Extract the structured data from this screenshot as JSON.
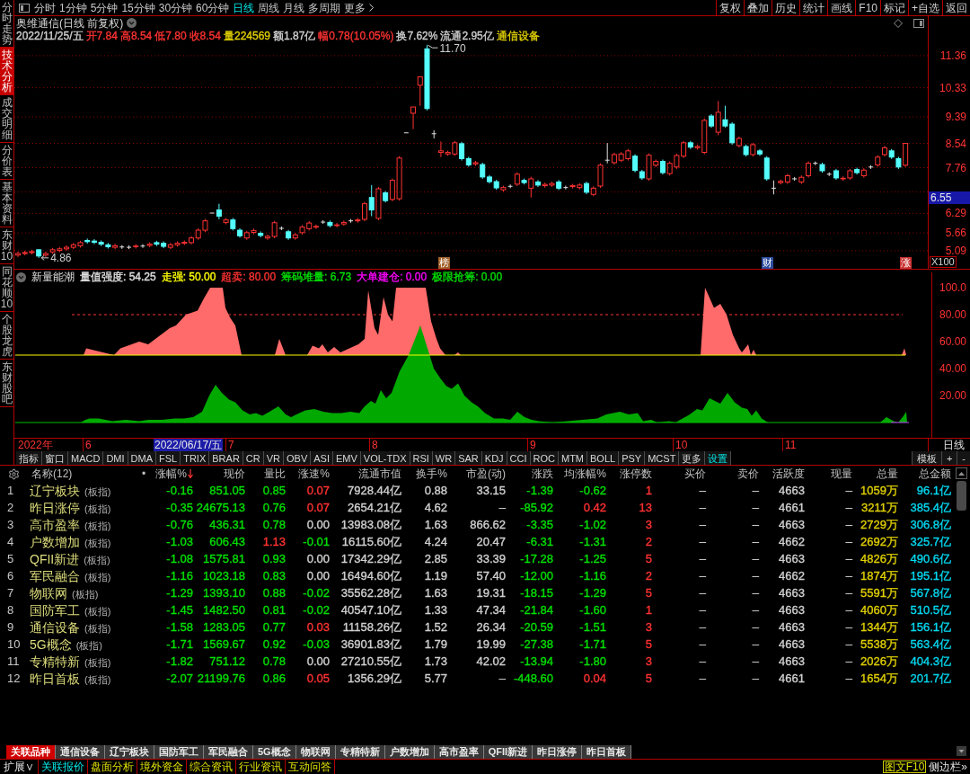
{
  "side_tabs": [
    {
      "label": "分时走势",
      "selected": false
    },
    {
      "label": "技术分析",
      "selected": true
    },
    {
      "label": "成交明细",
      "selected": false
    },
    {
      "label": "分价表",
      "selected": false
    },
    {
      "label": "基本资料",
      "selected": false
    },
    {
      "label": "东财10",
      "selected": false
    },
    {
      "label": "同花顺10",
      "selected": false
    },
    {
      "label": "个股龙虎",
      "selected": false
    },
    {
      "label": "东财股吧",
      "selected": false
    }
  ],
  "toolbar": {
    "period_tabs": [
      {
        "label": "分时",
        "selected": false
      },
      {
        "label": "1分钟",
        "selected": false
      },
      {
        "label": "5分钟",
        "selected": false
      },
      {
        "label": "15分钟",
        "selected": false
      },
      {
        "label": "30分钟",
        "selected": false
      },
      {
        "label": "60分钟",
        "selected": false
      },
      {
        "label": "日线",
        "selected": true
      },
      {
        "label": "周线",
        "selected": false
      },
      {
        "label": "月线",
        "selected": false
      },
      {
        "label": "多周期",
        "selected": false
      },
      {
        "label": "更多",
        "selected": false
      }
    ],
    "buttons": [
      "复权",
      "叠加",
      "历史",
      "统计",
      "画线",
      "F10",
      "标记",
      "+自选",
      "返回"
    ]
  },
  "price_chart": {
    "title": "奥维通信(日线 前复权)",
    "quote": [
      {
        "text": "2022/11/25/五",
        "color": "#d0d0d0"
      },
      {
        "text": "开7.84",
        "color": "#ff3232"
      },
      {
        "text": "高8.54",
        "color": "#ff3232"
      },
      {
        "text": "低7.80",
        "color": "#ff3232"
      },
      {
        "text": "收8.54",
        "color": "#ff3232"
      },
      {
        "text": "量224569",
        "color": "#e0d000"
      },
      {
        "text": "额1.87亿",
        "color": "#d0d0d0"
      },
      {
        "text": "幅0.78(10.05%)",
        "color": "#ff3232"
      },
      {
        "text": "换7.62%",
        "color": "#d0d0d0"
      },
      {
        "text": "流通2.95亿",
        "color": "#d0d0d0"
      },
      {
        "text": "通信设备",
        "color": "#e0d000"
      }
    ],
    "high_label": "11.70",
    "low_label": "4.86",
    "cursor_price": "6.55",
    "scale": "X100",
    "events": [
      {
        "text": "榜",
        "color": "#a0602a"
      },
      {
        "text": "财",
        "color": "#2c4c9c"
      },
      {
        "text": "涨",
        "color": "#c83232"
      }
    ],
    "chart_data": {
      "type": "candlestick",
      "categories": [
        null,
        null,
        null,
        null,
        null,
        null,
        null,
        null,
        null,
        null,
        null,
        null,
        null,
        null,
        null,
        null,
        null,
        null,
        null,
        null,
        null,
        null,
        null,
        null,
        null,
        null,
        null,
        null,
        null,
        null,
        null,
        null,
        null,
        null,
        null,
        null,
        null,
        null,
        null,
        null,
        null,
        null,
        null,
        null,
        null,
        null,
        null,
        null,
        null,
        null,
        null,
        null,
        null,
        null,
        null,
        null,
        null,
        null,
        null,
        null,
        null,
        null,
        null,
        null,
        null,
        null,
        null,
        null,
        null,
        null,
        null,
        null,
        null,
        null,
        null,
        null,
        null,
        null,
        null,
        null,
        null,
        null,
        null,
        null,
        null,
        null,
        null,
        null,
        null,
        null,
        null,
        null,
        null,
        null,
        null,
        null,
        null,
        null,
        null,
        null,
        null,
        null,
        null,
        null,
        null,
        null,
        null,
        null,
        null,
        null,
        null,
        null,
        null,
        null,
        null,
        null,
        null,
        null,
        null,
        null,
        null,
        null,
        null,
        null,
        null,
        null,
        null,
        null,
        null
      ],
      "ohlc": [
        [
          4.95,
          5.06,
          4.89,
          5.0
        ],
        [
          5.0,
          5.09,
          4.94,
          5.03
        ],
        [
          5.03,
          5.12,
          4.97,
          5.06
        ],
        [
          5.12,
          5.14,
          4.86,
          4.92
        ],
        [
          4.95,
          5.06,
          4.89,
          5.0
        ],
        [
          5.05,
          5.18,
          4.99,
          5.12
        ],
        [
          5.1,
          5.21,
          5.04,
          5.15
        ],
        [
          5.15,
          5.26,
          5.09,
          5.2
        ],
        [
          5.2,
          5.34,
          5.14,
          5.28
        ],
        [
          5.25,
          5.41,
          5.19,
          5.35
        ],
        [
          5.42,
          5.48,
          5.32,
          5.38
        ],
        [
          5.4,
          5.46,
          5.3,
          5.36
        ],
        [
          5.36,
          5.42,
          5.24,
          5.3
        ],
        [
          5.28,
          5.34,
          5.16,
          5.22
        ],
        [
          5.2,
          5.31,
          5.14,
          5.25
        ],
        [
          5.21,
          5.27,
          5.15,
          5.21
        ],
        [
          5.2,
          5.26,
          5.14,
          5.2
        ],
        [
          5.22,
          5.3,
          5.16,
          5.24
        ],
        [
          5.24,
          5.3,
          5.18,
          5.24
        ],
        [
          5.26,
          5.36,
          5.2,
          5.3
        ],
        [
          5.35,
          5.41,
          5.24,
          5.3
        ],
        [
          5.33,
          5.39,
          5.17,
          5.23
        ],
        [
          5.2,
          5.34,
          5.14,
          5.28
        ],
        [
          5.28,
          5.39,
          5.22,
          5.33
        ],
        [
          5.33,
          5.42,
          5.27,
          5.36
        ],
        [
          5.35,
          5.56,
          5.29,
          5.5
        ],
        [
          5.5,
          5.81,
          5.44,
          5.75
        ],
        [
          5.75,
          6.11,
          5.69,
          6.05
        ],
        [
          6.3,
          6.3,
          6.3,
          6.3
        ],
        [
          6.4,
          6.6,
          6.1,
          6.2
        ],
        [
          6.0,
          6.14,
          5.94,
          6.08
        ],
        [
          6.08,
          6.14,
          5.74,
          5.8
        ],
        [
          5.75,
          5.81,
          5.51,
          5.57
        ],
        [
          5.5,
          5.73,
          5.44,
          5.67
        ],
        [
          5.68,
          5.8,
          5.62,
          5.74
        ],
        [
          5.65,
          5.71,
          5.52,
          5.58
        ],
        [
          5.5,
          5.61,
          5.44,
          5.55
        ],
        [
          5.55,
          6.05,
          5.49,
          5.99
        ],
        [
          5.81,
          5.87,
          5.75,
          5.81
        ],
        [
          5.7,
          5.76,
          5.44,
          5.5
        ],
        [
          5.5,
          5.66,
          5.44,
          5.6
        ],
        [
          5.67,
          5.91,
          5.61,
          5.85
        ],
        [
          5.8,
          6.04,
          5.74,
          5.98
        ],
        [
          5.85,
          5.93,
          5.79,
          5.87
        ],
        [
          6.01,
          6.07,
          5.95,
          6.01
        ],
        [
          6.0,
          6.06,
          5.84,
          5.9
        ],
        [
          5.9,
          5.98,
          5.84,
          5.92
        ],
        [
          5.95,
          6.06,
          5.89,
          6.0
        ],
        [
          6.05,
          6.11,
          5.99,
          6.05
        ],
        [
          6.05,
          6.14,
          5.99,
          6.08
        ],
        [
          6.1,
          6.66,
          6.04,
          6.6
        ],
        [
          6.8,
          7.2,
          6.2,
          6.4
        ],
        [
          6.13,
          7.14,
          6.07,
          7.08
        ],
        [
          6.95,
          7.01,
          6.64,
          6.7
        ],
        [
          6.74,
          7.41,
          6.68,
          7.35
        ],
        [
          6.76,
          8.13,
          6.7,
          8.07
        ],
        [
          8.88,
          8.88,
          8.88,
          8.88
        ],
        [
          9.51,
          9.71,
          9.0,
          9.71
        ],
        [
          10.41,
          10.68,
          9.75,
          10.68
        ],
        [
          11.58,
          11.7,
          9.6,
          9.66
        ],
        [
          8.85,
          8.96,
          8.7,
          8.85
        ],
        [
          8.25,
          8.6,
          8.1,
          8.3
        ],
        [
          8.2,
          8.31,
          8.14,
          8.25
        ],
        [
          8.2,
          8.62,
          8.14,
          8.56
        ],
        [
          8.53,
          8.59,
          7.99,
          8.05
        ],
        [
          8.05,
          8.11,
          7.79,
          7.85
        ],
        [
          7.88,
          7.98,
          7.82,
          7.92
        ],
        [
          7.86,
          7.92,
          7.4,
          7.46
        ],
        [
          7.46,
          7.52,
          7.25,
          7.31
        ],
        [
          7.31,
          7.37,
          7.05,
          7.11
        ],
        [
          7.05,
          7.18,
          6.99,
          7.12
        ],
        [
          7.16,
          7.22,
          7.1,
          7.16
        ],
        [
          7.23,
          7.61,
          7.17,
          7.55
        ],
        [
          7.35,
          7.41,
          7.22,
          7.28
        ],
        [
          7.1,
          7.47,
          6.8,
          7.4
        ],
        [
          7.3,
          7.36,
          7.14,
          7.2
        ],
        [
          7.18,
          7.28,
          7.12,
          7.22
        ],
        [
          7.2,
          7.31,
          7.14,
          7.25
        ],
        [
          7.3,
          7.36,
          7.04,
          7.1
        ],
        [
          7.12,
          7.18,
          7.06,
          7.12
        ],
        [
          7.15,
          7.24,
          7.09,
          7.18
        ],
        [
          7.12,
          7.26,
          7.06,
          7.2
        ],
        [
          7.25,
          7.31,
          6.91,
          6.97
        ],
        [
          6.9,
          7.16,
          6.84,
          7.1
        ],
        [
          7.17,
          7.9,
          7.11,
          7.84
        ],
        [
          8.0,
          8.55,
          7.9,
          8.0
        ],
        [
          7.92,
          8.24,
          7.86,
          8.18
        ],
        [
          8.0,
          8.26,
          7.94,
          8.2
        ],
        [
          8.05,
          8.36,
          7.99,
          8.3
        ],
        [
          8.13,
          8.19,
          7.61,
          7.67
        ],
        [
          7.63,
          7.69,
          7.37,
          7.43
        ],
        [
          7.4,
          8.22,
          7.34,
          8.16
        ],
        [
          7.84,
          8.02,
          7.78,
          7.96
        ],
        [
          7.96,
          8.02,
          7.54,
          7.6
        ],
        [
          7.57,
          7.96,
          7.51,
          7.9
        ],
        [
          7.78,
          8.21,
          7.72,
          8.15
        ],
        [
          8.13,
          8.62,
          8.07,
          8.56
        ],
        [
          8.56,
          8.62,
          8.36,
          8.42
        ],
        [
          8.4,
          8.5,
          8.34,
          8.44
        ],
        [
          8.25,
          9.34,
          8.19,
          9.28
        ],
        [
          9.42,
          9.48,
          9.04,
          9.1
        ],
        [
          8.9,
          9.9,
          8.8,
          9.54
        ],
        [
          9.3,
          9.75,
          9.05,
          9.1
        ],
        [
          9.16,
          9.22,
          8.5,
          8.56
        ],
        [
          8.47,
          8.76,
          8.41,
          8.7
        ],
        [
          8.44,
          8.5,
          8.12,
          8.18
        ],
        [
          8.18,
          8.56,
          8.12,
          8.5
        ],
        [
          8.3,
          8.36,
          8.14,
          8.2
        ],
        [
          8.07,
          8.13,
          7.34,
          7.4
        ],
        [
          7.1,
          7.35,
          6.9,
          7.1
        ],
        [
          7.28,
          7.38,
          7.22,
          7.32
        ],
        [
          7.3,
          7.56,
          7.24,
          7.5
        ],
        [
          7.4,
          7.46,
          7.34,
          7.4
        ],
        [
          7.3,
          7.51,
          7.24,
          7.45
        ],
        [
          7.5,
          7.96,
          7.44,
          7.9
        ],
        [
          7.9,
          7.96,
          7.84,
          7.9
        ],
        [
          7.86,
          7.92,
          7.6,
          7.66
        ],
        [
          7.55,
          7.61,
          7.49,
          7.55
        ],
        [
          7.66,
          7.72,
          7.37,
          7.43
        ],
        [
          7.4,
          7.48,
          7.34,
          7.42
        ],
        [
          7.43,
          7.72,
          7.37,
          7.66
        ],
        [
          7.7,
          7.76,
          7.54,
          7.6
        ],
        [
          7.5,
          7.74,
          7.44,
          7.68
        ],
        [
          7.78,
          7.84,
          7.72,
          7.78
        ],
        [
          7.85,
          8.16,
          7.79,
          8.1
        ],
        [
          8.18,
          8.46,
          8.12,
          8.4
        ],
        [
          8.3,
          8.36,
          8.04,
          8.1
        ],
        [
          8.05,
          8.11,
          7.72,
          7.78
        ],
        [
          7.84,
          8.54,
          7.78,
          8.54
        ]
      ],
      "ylim": [
        4.48,
        12.63
      ],
      "grid": true,
      "yticks": [
        {
          "value": 11.36,
          "label": "11.36"
        },
        {
          "value": 10.33,
          "label": "10.33"
        },
        {
          "value": 9.39,
          "label": "9.39"
        },
        {
          "value": 8.54,
          "label": "8.54"
        },
        {
          "value": 7.76,
          "label": "7.76"
        },
        {
          "value": 6.29,
          "label": "6.29"
        },
        {
          "value": 5.66,
          "label": "5.66"
        },
        {
          "value": 5.09,
          "label": "5.09"
        }
      ]
    }
  },
  "indicator": {
    "name": "新量能潮",
    "readings": [
      {
        "text": "量值强度: 54.25",
        "color": "#e0e0e0"
      },
      {
        "text": "走强: 50.00",
        "color": "#ffff00"
      },
      {
        "text": "超卖: 80.00",
        "color": "#ff3232"
      },
      {
        "text": "筹码堆量: 6.73",
        "color": "#00e000"
      },
      {
        "text": "大单建仓: 0.00",
        "color": "#ff00ff"
      },
      {
        "text": "极限抢筹: 0.00",
        "color": "#00e000"
      }
    ],
    "y_axis": [
      "100.0",
      "80.00",
      "60.00",
      "40.00",
      "20.00"
    ]
  },
  "date_axis": {
    "year": "2022年",
    "months": [
      "6",
      "7",
      "8",
      "9",
      "10",
      "11"
    ],
    "cursor_date": "2022/06/17/五",
    "period": "日线"
  },
  "indicator_tabs": [
    {
      "label": "指标",
      "selected": false
    },
    {
      "label": "窗口",
      "selected": false
    },
    {
      "label": "MACD",
      "selected": false
    },
    {
      "label": "DMI",
      "selected": false
    },
    {
      "label": "DMA",
      "selected": false
    },
    {
      "label": "FSL",
      "selected": false
    },
    {
      "label": "TRIX",
      "selected": false
    },
    {
      "label": "BRAR",
      "selected": false
    },
    {
      "label": "CR",
      "selected": false
    },
    {
      "label": "VR",
      "selected": false
    },
    {
      "label": "OBV",
      "selected": false
    },
    {
      "label": "ASI",
      "selected": false
    },
    {
      "label": "EMV",
      "selected": false
    },
    {
      "label": "VOL-TDX",
      "selected": false
    },
    {
      "label": "RSI",
      "selected": false
    },
    {
      "label": "WR",
      "selected": false
    },
    {
      "label": "SAR",
      "selected": false
    },
    {
      "label": "KDJ",
      "selected": false
    },
    {
      "label": "CCI",
      "selected": false
    },
    {
      "label": "ROC",
      "selected": false
    },
    {
      "label": "MTM",
      "selected": false
    },
    {
      "label": "BOLL",
      "selected": false
    },
    {
      "label": "PSY",
      "selected": false
    },
    {
      "label": "MCST",
      "selected": false
    },
    {
      "label": "更多",
      "selected": false
    },
    {
      "label": "设置",
      "selected": true
    }
  ],
  "template_buttons": [
    "模板",
    "+",
    "-"
  ],
  "table": {
    "name_header": "名称(12)",
    "dot_header": "•",
    "columns": [
      {
        "label": "涨幅%",
        "kind": "signed",
        "sorted": true
      },
      {
        "label": "现价",
        "kind": "signed",
        "sorted": false
      },
      {
        "label": "量比",
        "kind": "signed",
        "sorted": false
      },
      {
        "label": "涨速%",
        "kind": "signed",
        "sorted": false
      },
      {
        "label": "流通市值",
        "kind": "plain",
        "sorted": false
      },
      {
        "label": "换手%",
        "kind": "plain",
        "sorted": false
      },
      {
        "label": "市盈(动)",
        "kind": "plain",
        "sorted": false
      },
      {
        "label": "涨跌",
        "kind": "signed",
        "sorted": false
      },
      {
        "label": "均涨幅%",
        "kind": "signed",
        "sorted": false
      },
      {
        "label": "涨停数",
        "kind": "count",
        "sorted": false
      },
      {
        "label": "买价",
        "kind": "plain",
        "sorted": false
      },
      {
        "label": "卖价",
        "kind": "plain",
        "sorted": false
      },
      {
        "label": "活跃度",
        "kind": "plain",
        "sorted": false
      },
      {
        "label": "现量",
        "kind": "plain",
        "sorted": false
      },
      {
        "label": "总量",
        "kind": "volume",
        "sorted": false
      },
      {
        "label": "总金额",
        "kind": "amount",
        "sorted": false
      }
    ],
    "rows": [
      {
        "index": "1",
        "name": "辽宁板块",
        "tag": "(板指)",
        "cells": [
          {
            "text": "-0.16",
            "color": "#00e000"
          },
          {
            "text": "851.05",
            "color": "#00e000"
          },
          {
            "text": "0.85",
            "color": "#00e000"
          },
          {
            "text": "0.07",
            "color": "#ff3232"
          },
          "7928.44亿",
          "0.88",
          "33.15",
          {
            "text": "-1.39",
            "color": "#00e000"
          },
          {
            "text": "-0.62",
            "color": "#00e000"
          },
          "1",
          "–",
          "–",
          "4663",
          "–",
          "1059万",
          "96.1亿"
        ]
      },
      {
        "index": "2",
        "name": "昨日涨停",
        "tag": "(板指)",
        "cells": [
          {
            "text": "-0.35",
            "color": "#00e000"
          },
          {
            "text": "24675.13",
            "color": "#00e000"
          },
          {
            "text": "0.76",
            "color": "#00e000"
          },
          {
            "text": "0.07",
            "color": "#ff3232"
          },
          "2654.21亿",
          "4.62",
          "–",
          {
            "text": "-85.92",
            "color": "#00e000"
          },
          {
            "text": "0.42",
            "color": "#ff3232"
          },
          "13",
          "–",
          "–",
          "4661",
          "–",
          "3211万",
          "385.4亿"
        ]
      },
      {
        "index": "3",
        "name": "高市盈率",
        "tag": "(板指)",
        "cells": [
          {
            "text": "-0.76",
            "color": "#00e000"
          },
          {
            "text": "436.31",
            "color": "#00e000"
          },
          {
            "text": "0.78",
            "color": "#00e000"
          },
          {
            "text": "0.00",
            "color": "#d0d0d0"
          },
          "13983.08亿",
          "1.63",
          "866.62",
          {
            "text": "-3.35",
            "color": "#00e000"
          },
          {
            "text": "-1.02",
            "color": "#00e000"
          },
          "3",
          "–",
          "–",
          "4663",
          "–",
          "2729万",
          "306.8亿"
        ]
      },
      {
        "index": "4",
        "name": "户数增加",
        "tag": "(板指)",
        "cells": [
          {
            "text": "-1.03",
            "color": "#00e000"
          },
          {
            "text": "606.43",
            "color": "#00e000"
          },
          {
            "text": "1.13",
            "color": "#ff3232"
          },
          {
            "text": "-0.01",
            "color": "#00e000"
          },
          "16115.60亿",
          "4.24",
          "20.47",
          {
            "text": "-6.31",
            "color": "#00e000"
          },
          {
            "text": "-1.31",
            "color": "#00e000"
          },
          "2",
          "–",
          "–",
          "4662",
          "–",
          "2692万",
          "325.7亿"
        ]
      },
      {
        "index": "5",
        "name": "QFII新进",
        "tag": "(板指)",
        "cells": [
          {
            "text": "-1.08",
            "color": "#00e000"
          },
          {
            "text": "1575.81",
            "color": "#00e000"
          },
          {
            "text": "0.93",
            "color": "#00e000"
          },
          {
            "text": "0.00",
            "color": "#d0d0d0"
          },
          "17342.29亿",
          "2.85",
          "33.39",
          {
            "text": "-17.28",
            "color": "#00e000"
          },
          {
            "text": "-1.25",
            "color": "#00e000"
          },
          "5",
          "–",
          "–",
          "4663",
          "–",
          "4826万",
          "490.6亿"
        ]
      },
      {
        "index": "6",
        "name": "军民融合",
        "tag": "(板指)",
        "cells": [
          {
            "text": "-1.16",
            "color": "#00e000"
          },
          {
            "text": "1023.18",
            "color": "#00e000"
          },
          {
            "text": "0.83",
            "color": "#00e000"
          },
          {
            "text": "0.00",
            "color": "#d0d0d0"
          },
          "16494.60亿",
          "1.19",
          "57.40",
          {
            "text": "-12.00",
            "color": "#00e000"
          },
          {
            "text": "-1.16",
            "color": "#00e000"
          },
          "2",
          "–",
          "–",
          "4662",
          "–",
          "1874万",
          "195.1亿"
        ]
      },
      {
        "index": "7",
        "name": "物联网",
        "tag": "(板指)",
        "cells": [
          {
            "text": "-1.29",
            "color": "#00e000"
          },
          {
            "text": "1393.10",
            "color": "#00e000"
          },
          {
            "text": "0.88",
            "color": "#00e000"
          },
          {
            "text": "-0.02",
            "color": "#00e000"
          },
          "35562.28亿",
          "1.63",
          "19.31",
          {
            "text": "-18.15",
            "color": "#00e000"
          },
          {
            "text": "-1.29",
            "color": "#00e000"
          },
          "5",
          "–",
          "–",
          "4663",
          "–",
          "5591万",
          "567.8亿"
        ]
      },
      {
        "index": "8",
        "name": "国防军工",
        "tag": "(板指)",
        "cells": [
          {
            "text": "-1.45",
            "color": "#00e000"
          },
          {
            "text": "1482.50",
            "color": "#00e000"
          },
          {
            "text": "0.81",
            "color": "#00e000"
          },
          {
            "text": "-0.02",
            "color": "#00e000"
          },
          "40547.10亿",
          "1.33",
          "47.34",
          {
            "text": "-21.84",
            "color": "#00e000"
          },
          {
            "text": "-1.60",
            "color": "#00e000"
          },
          "1",
          "–",
          "–",
          "4663",
          "–",
          "4060万",
          "510.5亿"
        ]
      },
      {
        "index": "9",
        "name": "通信设备",
        "tag": "(板指)",
        "cells": [
          {
            "text": "-1.58",
            "color": "#00e000"
          },
          {
            "text": "1283.05",
            "color": "#00e000"
          },
          {
            "text": "0.77",
            "color": "#00e000"
          },
          {
            "text": "0.03",
            "color": "#ff3232"
          },
          "11158.26亿",
          "1.52",
          "26.34",
          {
            "text": "-20.59",
            "color": "#00e000"
          },
          {
            "text": "-1.51",
            "color": "#00e000"
          },
          "3",
          "–",
          "–",
          "4663",
          "–",
          "1344万",
          "156.1亿"
        ]
      },
      {
        "index": "10",
        "name": "5G概念",
        "tag": "(板指)",
        "cells": [
          {
            "text": "-1.71",
            "color": "#00e000"
          },
          {
            "text": "1569.67",
            "color": "#00e000"
          },
          {
            "text": "0.92",
            "color": "#00e000"
          },
          {
            "text": "-0.03",
            "color": "#00e000"
          },
          "36901.83亿",
          "1.79",
          "19.99",
          {
            "text": "-27.38",
            "color": "#00e000"
          },
          {
            "text": "-1.71",
            "color": "#00e000"
          },
          "5",
          "–",
          "–",
          "4663",
          "–",
          "5538万",
          "563.4亿"
        ]
      },
      {
        "index": "11",
        "name": "专精特新",
        "tag": "(板指)",
        "cells": [
          {
            "text": "-1.82",
            "color": "#00e000"
          },
          {
            "text": "751.12",
            "color": "#00e000"
          },
          {
            "text": "0.78",
            "color": "#00e000"
          },
          {
            "text": "0.00",
            "color": "#d0d0d0"
          },
          "27210.55亿",
          "1.73",
          "42.02",
          {
            "text": "-13.94",
            "color": "#00e000"
          },
          {
            "text": "-1.80",
            "color": "#00e000"
          },
          "3",
          "–",
          "–",
          "4663",
          "–",
          "2026万",
          "404.3亿"
        ]
      },
      {
        "index": "12",
        "name": "昨日首板",
        "tag": "(板指)",
        "cells": [
          {
            "text": "-2.07",
            "color": "#00e000"
          },
          {
            "text": "21199.76",
            "color": "#00e000"
          },
          {
            "text": "0.86",
            "color": "#00e000"
          },
          {
            "text": "0.05",
            "color": "#ff3232"
          },
          "1356.29亿",
          "5.77",
          "–",
          {
            "text": "-448.60",
            "color": "#00e000"
          },
          {
            "text": "0.04",
            "color": "#ff3232"
          },
          "5",
          "–",
          "–",
          "4661",
          "–",
          "1654万",
          "201.7亿"
        ]
      }
    ]
  },
  "related_tabs": [
    {
      "label": "关联品种",
      "selected": true
    },
    {
      "label": "通信设备",
      "selected": false
    },
    {
      "label": "辽宁板块",
      "selected": false
    },
    {
      "label": "国防军工",
      "selected": false
    },
    {
      "label": "军民融合",
      "selected": false
    },
    {
      "label": "5G概念",
      "selected": false
    },
    {
      "label": "物联网",
      "selected": false
    },
    {
      "label": "专精特新",
      "selected": false
    },
    {
      "label": "户数增加",
      "selected": false
    },
    {
      "label": "高市盈率",
      "selected": false
    },
    {
      "label": "QFII新进",
      "selected": false
    },
    {
      "label": "昨日涨停",
      "selected": false
    },
    {
      "label": "昨日首板",
      "selected": false
    }
  ],
  "status_bar": {
    "expand": "扩展∨",
    "tabs": [
      {
        "label": "关联报价",
        "selected": true
      },
      {
        "label": "盘面分析",
        "selected": false
      },
      {
        "label": "境外资金",
        "selected": false
      },
      {
        "label": "综合资讯",
        "selected": false
      },
      {
        "label": "行业资讯",
        "selected": false
      },
      {
        "label": "互动问答",
        "selected": false
      }
    ],
    "f10": "图文F10",
    "sidebar": "侧边栏»"
  }
}
